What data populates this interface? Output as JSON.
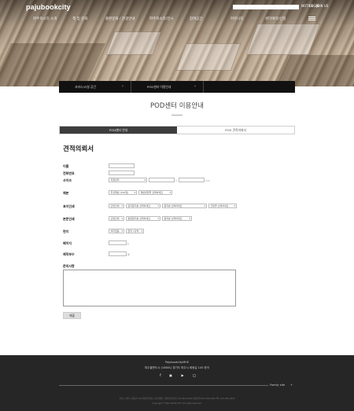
{
  "header": {
    "logo": "pajubookcity",
    "search": {
      "placeholder": "",
      "value": ""
    },
    "util_links": [
      "NOTICE",
      "LOGIN",
      "JOIN US"
    ],
    "nav": [
      "파주북시티 소개",
      "책 및 문화",
      "출판문화 / 관광안내",
      "파주북소리/전시",
      "참여공간",
      "커뮤니티",
      "센터예약/신청"
    ],
    "menu_icon": "hamburger-icon"
  },
  "breadcrumb": [
    {
      "label": "서비스/시설 공간",
      "icon": "chevron-right-icon"
    },
    {
      "label": "POD센터 이용안내",
      "icon": "chevron-right-icon"
    }
  ],
  "page_title": "POD센터 이용안내",
  "tabs": [
    {
      "label": "POD센터 안내",
      "active": true
    },
    {
      "label": "POD 견적의뢰서",
      "active": false
    }
  ],
  "form": {
    "heading": "견적의뢰서",
    "labels": {
      "name": "이름",
      "phone": "전화번호",
      "size": "사이즈",
      "binding": "제본",
      "cover": "표지인쇄",
      "body": "본문인쇄",
      "wing": "면지",
      "pages": "페이지",
      "copies": "제작부수",
      "inquiry": "문의사항"
    },
    "values": {
      "size_select": "직접입력",
      "size_unit_x": "x",
      "size_unit_mm": "mm",
      "binding_1": "무선제본 (200권)",
      "binding_2": "제본방향을 선택하세요",
      "cover_1": "단면인쇄",
      "cover_2": "표지용지를 선택하세요",
      "cover_3": "용지를 선택하세요",
      "cover_4": "코팅을 선택하세요",
      "body_1": "단면인쇄",
      "body_2": "본문용지를 선택하세요",
      "body_3": "용지를 선택하세요",
      "wing_1": "색지없음",
      "wing_2": "앞뒤 1장씩",
      "pages_unit": "p",
      "copies_unit": "부"
    },
    "submit": "제출"
  },
  "footer": {
    "line1": "PajubookcityMHS",
    "line2": "파주출판도시 (10881) 경기도 파주시 회동길 145 한국",
    "social_icons": [
      "facebook-icon",
      "blog-icon",
      "youtube-icon",
      "instagram-icon"
    ],
    "family_site": "Family site",
    "family_arrow": "+",
    "address": "경기도 파주시 회동길 145 ㈜파주출판도시문화재단 사업자등록번호 141-82-01450 대표전화 031-955-0050 팩스 031-955-0052",
    "copyright": "Copyright © PAJU BOOK CITY. All rights reserved."
  }
}
